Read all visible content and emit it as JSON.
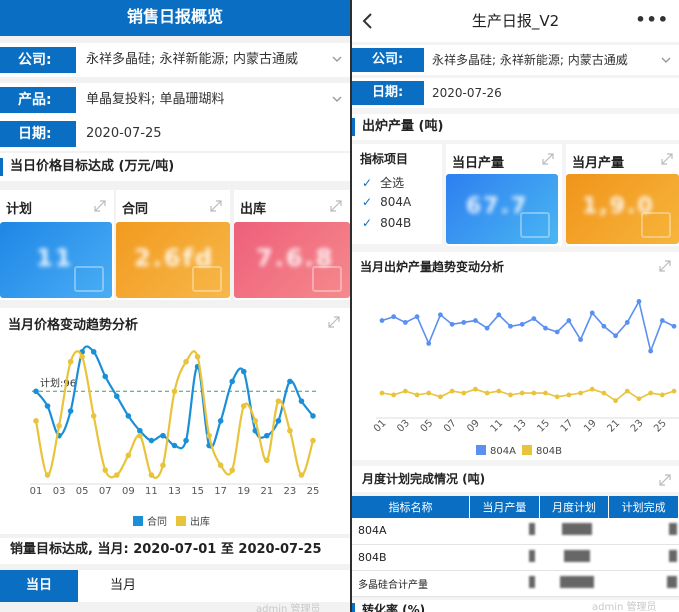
{
  "left": {
    "title": "销售日报概览",
    "filters": [
      {
        "label": "公司:",
        "value": "永祥多晶硅; 永祥新能源; 内蒙古通威",
        "dropdown": true
      },
      {
        "label": "产品:",
        "value": "单晶复投料; 单晶珊瑚料",
        "dropdown": true
      },
      {
        "label": "日期:",
        "value": "2020-07-25",
        "dropdown": false
      }
    ],
    "price_section": "当日价格目标达成 (万元/吨)",
    "kpis": [
      {
        "label": "计划",
        "value": "11",
        "color_from": "#1f86e6",
        "color_to": "#4aaef5"
      },
      {
        "label": "合同",
        "value": "2.6fd",
        "color_from": "#f29a1f",
        "color_to": "#f7b84a"
      },
      {
        "label": "出库",
        "value": "7.6.8",
        "color_from": "#ee5f7a",
        "color_to": "#f58a8c"
      }
    ],
    "trend_title": "当月价格变动趋势分析",
    "plan_annotation": "计划:96",
    "legend": [
      {
        "name": "合同",
        "color": "#1a8fd8"
      },
      {
        "name": "出库",
        "color": "#e8c43c"
      }
    ],
    "chart_data": {
      "type": "line",
      "x": [
        "01",
        "02",
        "03",
        "04",
        "05",
        "06",
        "07",
        "08",
        "09",
        "10",
        "11",
        "12",
        "13",
        "14",
        "15",
        "16",
        "17",
        "18",
        "19",
        "20",
        "21",
        "22",
        "23",
        "24",
        "25"
      ],
      "x_tick_labels": [
        "01",
        "03",
        "05",
        "07",
        "09",
        "11",
        "13",
        "15",
        "17",
        "19",
        "21",
        "23",
        "25"
      ],
      "series": [
        {
          "name": "合同",
          "color": "#1a8fd8",
          "values": [
            96,
            93,
            87,
            92,
            104,
            104,
            99,
            95,
            91,
            88,
            86,
            87,
            85,
            86,
            101,
            85,
            90,
            98,
            100,
            88,
            87,
            90,
            98,
            94,
            91
          ]
        },
        {
          "name": "出库",
          "color": "#e8c43c",
          "values": [
            90,
            79,
            89,
            102,
            103,
            91,
            80,
            79,
            83,
            87,
            79,
            81,
            96,
            102,
            103,
            87,
            81,
            80,
            93,
            90,
            82,
            94,
            88,
            79,
            86
          ]
        }
      ],
      "plan_line": 96,
      "ylim": [
        78,
        106
      ],
      "grid": false,
      "legend_position": "bottom"
    },
    "sales_section": "销量目标达成, 当月: 2020-07-01 至 2020-07-25",
    "tabs": [
      {
        "label": "当日",
        "active": true
      },
      {
        "label": "当月",
        "active": false
      }
    ],
    "watermark": "admin 管理员"
  },
  "right": {
    "title": "生产日报_V2",
    "filters": [
      {
        "label": "公司:",
        "value": "永祥多晶硅; 永祥新能源; 内蒙古通威",
        "dropdown": true
      },
      {
        "label": "日期:",
        "value": "2020-07-26",
        "dropdown": false
      }
    ],
    "output_section": "出炉产量 (吨)",
    "indicator_title": "指标项目",
    "indicators": [
      "全选",
      "804A",
      "804B"
    ],
    "kpis": [
      {
        "label": "当日产量",
        "value": "67.7",
        "color_from": "#2d7ff0",
        "color_to": "#4ab6f2"
      },
      {
        "label": "当月产量",
        "value": "1,9.0",
        "color_from": "#f0941a",
        "color_to": "#f7b53c"
      }
    ],
    "trend_title": "当月出炉产量趋势变动分析",
    "legend": [
      {
        "name": "804A",
        "color": "#5b8ff2"
      },
      {
        "name": "804B",
        "color": "#e8c43c"
      }
    ],
    "chart_data": {
      "type": "line",
      "x": [
        "01",
        "02",
        "03",
        "04",
        "05",
        "06",
        "07",
        "08",
        "09",
        "10",
        "11",
        "12",
        "13",
        "14",
        "15",
        "16",
        "17",
        "18",
        "19",
        "20",
        "21",
        "22",
        "23",
        "24",
        "25",
        "26"
      ],
      "x_tick_labels": [
        "01",
        "03",
        "05",
        "07",
        "09",
        "11",
        "13",
        "15",
        "17",
        "19",
        "21",
        "23",
        "25"
      ],
      "series": [
        {
          "name": "804A",
          "color": "#5b8ff2",
          "values": [
            74,
            76,
            73,
            76,
            62,
            77,
            72,
            73,
            74,
            70,
            77,
            71,
            72,
            75,
            70,
            68,
            74,
            64,
            78,
            71,
            66,
            73,
            84,
            58,
            74,
            71
          ]
        },
        {
          "name": "804B",
          "color": "#e8c43c",
          "values": [
            36,
            35,
            37,
            35,
            36,
            34,
            37,
            36,
            38,
            36,
            37,
            35,
            36,
            36,
            36,
            34,
            35,
            36,
            38,
            36,
            32,
            37,
            33,
            36,
            35,
            37
          ]
        }
      ],
      "ylim": [
        25,
        90
      ],
      "grid": false,
      "legend_position": "bottom"
    },
    "plan_section": "月度计划完成情况 (吨)",
    "table": {
      "headers": [
        "指标名称",
        "当月产量",
        "月度计划",
        "计划完成"
      ],
      "rows": [
        "804A",
        "804B",
        "多晶硅合计产量"
      ]
    },
    "next_section": "转化率 (%)",
    "watermark": "admin 管理员"
  }
}
